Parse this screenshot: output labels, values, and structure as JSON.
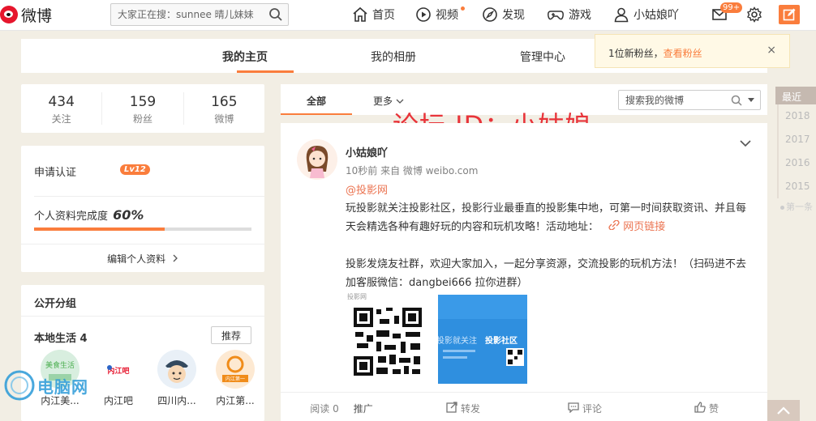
{
  "topbar": {
    "logo_text": "微博",
    "search_placeholder": "大家正在搜：sunnee 晴儿妹妹",
    "nav": {
      "home": "首页",
      "video": "视频",
      "discover": "发现",
      "games": "游戏",
      "user": "小姑娘吖"
    },
    "message_badge": "99+",
    "accent_color": "#fa7d3c"
  },
  "profile_tabs": {
    "my_home": "我的主页",
    "my_album": "我的相册",
    "manage_center": "管理中心"
  },
  "notice": {
    "text": "1位新粉丝，",
    "link": "查看粉丝",
    "close": "×"
  },
  "stats": [
    {
      "num": "434",
      "label": "关注"
    },
    {
      "num": "159",
      "label": "粉丝"
    },
    {
      "num": "165",
      "label": "微博"
    }
  ],
  "info": {
    "verify": "申请认证",
    "level": "Lv12",
    "complete_label": "个人资料完成度",
    "complete_pct": "60%",
    "complete_fraction": 0.6,
    "edit": "编辑个人资料"
  },
  "groups": {
    "title": "公开分组",
    "local_title": "本地生活 4",
    "recommend": "推荐",
    "items": [
      {
        "label": "内江美..."
      },
      {
        "label": "内江吧"
      },
      {
        "label": "四川内..."
      },
      {
        "label": "内江第..."
      }
    ],
    "avatar_texts": {
      "first": "美食生活",
      "second": "内江吧",
      "fourth": "内江第一"
    }
  },
  "feed": {
    "tab_all": "全部",
    "tab_more": "更多",
    "search_placeholder": "搜索我的微博",
    "watermark": "论坛 ID：小姑娘"
  },
  "post": {
    "name": "小姑娘吖",
    "meta": "10秒前 来自 微博 weibo.com",
    "mention": "@投影网",
    "para1": "玩投影就关注投影社区，投影行业最垂直的投影集中地，可第一时间获取资讯、并且每天会精选各种有趣好玩的内容和玩机攻略！活动地址：",
    "link": "网页链接",
    "para2": "投影发烧友社群，欢迎大家加入，一起分享资源，交流投影的玩机方法！（扫码进不去加客服微信：dangbei666 拉你进群）",
    "img1_tag": "投影网",
    "img2_text": "投影就关注",
    "img2_text2": "投影社区",
    "actions": {
      "read": "阅读 0",
      "promote": "推广",
      "forward": "转发",
      "comment": "评论",
      "like": "赞"
    }
  },
  "timeline": {
    "recent": "最近",
    "years": [
      "2018",
      "2017",
      "2016",
      "2015"
    ],
    "first": "第一条"
  },
  "brand_logo": "电脑网"
}
